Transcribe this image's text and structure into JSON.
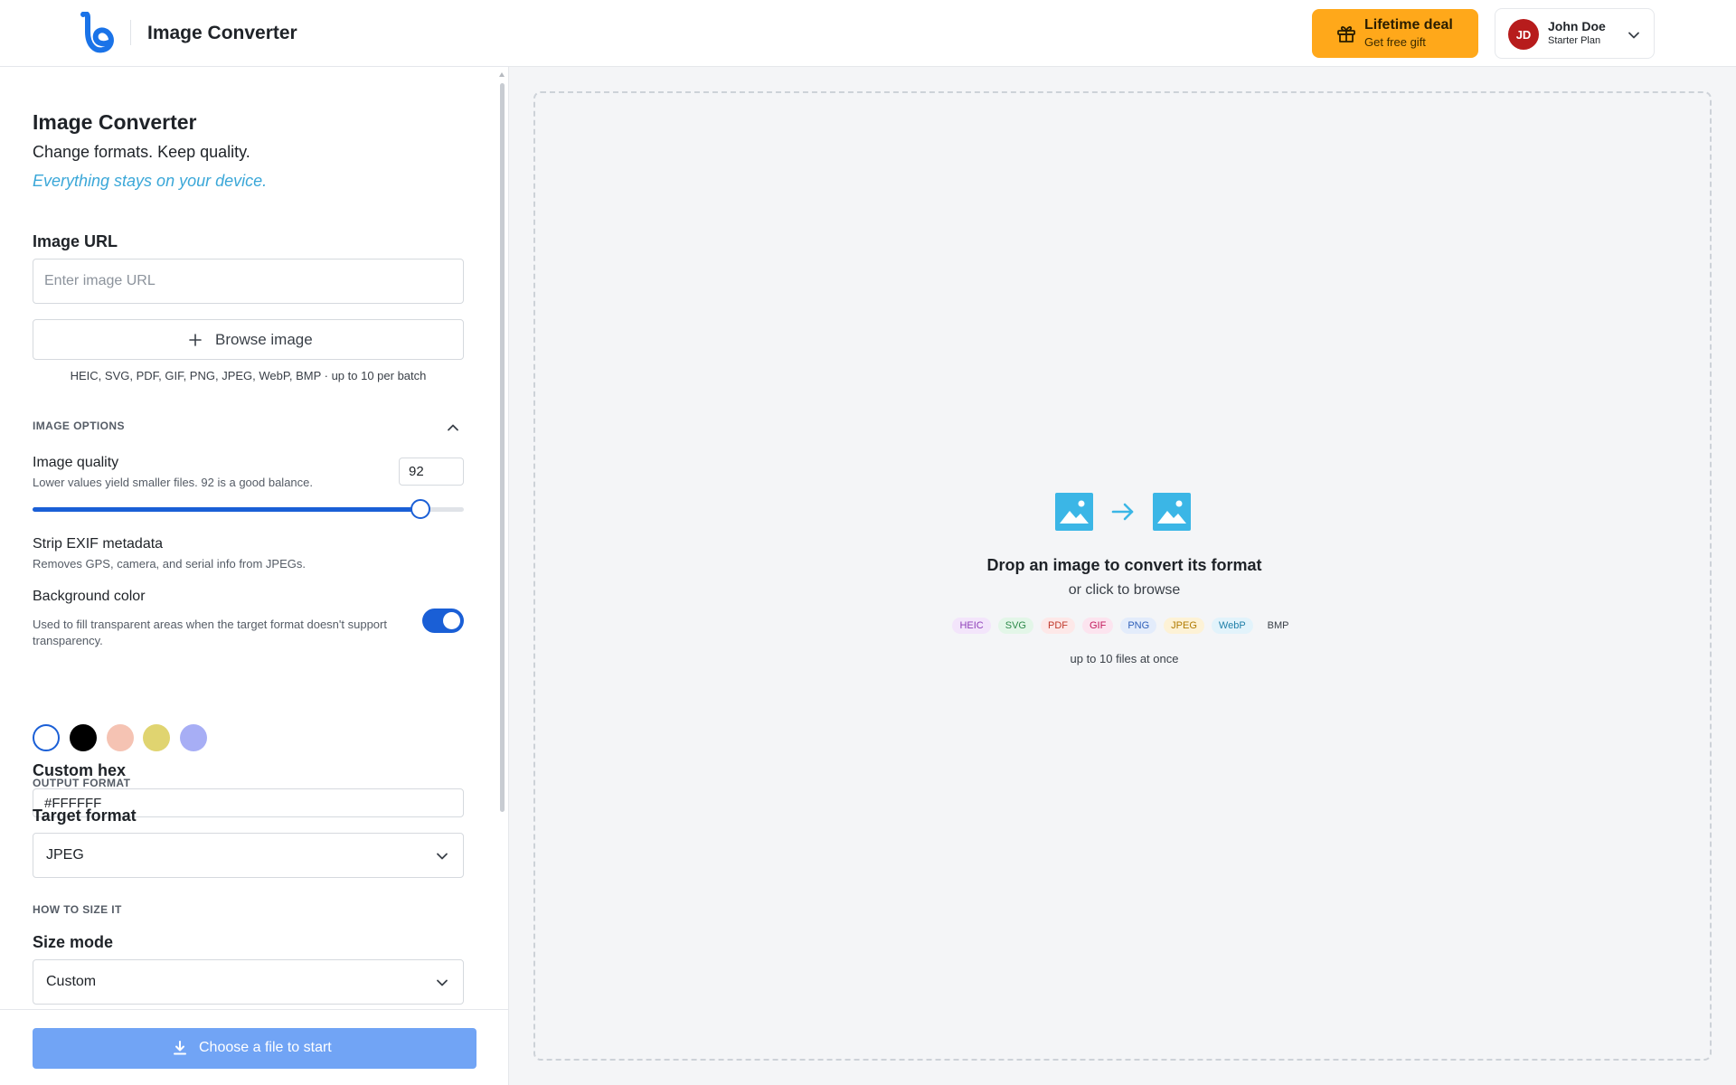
{
  "header": {
    "app_title": "Image Converter",
    "deal": {
      "title": "Lifetime deal",
      "subtitle": "Get free gift"
    },
    "user": {
      "initials": "JD",
      "name": "John Doe",
      "plan": "Starter Plan"
    }
  },
  "sidebar": {
    "title": "Image Converter",
    "subtitle": "Change formats. Keep quality.",
    "tagline": "Everything stays on your device.",
    "image_url": {
      "label": "Image URL",
      "placeholder": "Enter image URL",
      "value": ""
    },
    "browse_label": "Browse image",
    "formats_hint": "HEIC, SVG, PDF, GIF, PNG, JPEG, WebP, BMP · up to 10 per batch",
    "image_options": {
      "heading": "IMAGE OPTIONS",
      "quality": {
        "label": "Image quality",
        "desc": "Lower values yield smaller files. 92 is a good balance.",
        "value": "92",
        "slider_percent": 90
      },
      "strip_exif": {
        "label": "Strip EXIF metadata",
        "desc": "Removes GPS, camera, and serial info from JPEGs.",
        "enabled": true
      },
      "background": {
        "label": "Background color",
        "desc": "Used to fill transparent areas when the target format doesn't support transparency.",
        "swatches": [
          "#FFFFFF",
          "#000000",
          "#F5C3B3",
          "#E0D470",
          "#A7AEF5"
        ],
        "selected": "#FFFFFF"
      },
      "custom_hex": {
        "label": "Custom hex",
        "value": "#FFFFFF"
      }
    },
    "output_format": {
      "heading": "OUTPUT FORMAT",
      "label": "Target format",
      "value": "JPEG"
    },
    "sizing": {
      "heading": "HOW TO SIZE IT",
      "label": "Size mode",
      "value": "Custom"
    },
    "start_label": "Choose a file to start"
  },
  "dropzone": {
    "title": "Drop an image to convert its format",
    "subtitle": "or click to browse",
    "formats": [
      {
        "label": "HEIC",
        "bg": "#f3e5fb",
        "fg": "#8e3fb8"
      },
      {
        "label": "SVG",
        "bg": "#e3f6e8",
        "fg": "#2d8a4a"
      },
      {
        "label": "PDF",
        "bg": "#fde8e8",
        "fg": "#c0392b"
      },
      {
        "label": "GIF",
        "bg": "#fce4ef",
        "fg": "#c2185b"
      },
      {
        "label": "PNG",
        "bg": "#e3ecfb",
        "fg": "#2f5fb8"
      },
      {
        "label": "JPEG",
        "bg": "#fdf2d6",
        "fg": "#b07a00"
      },
      {
        "label": "WebP",
        "bg": "#e2f3fb",
        "fg": "#1f7fa8"
      },
      {
        "label": "BMP",
        "bg": "#f4f5f7",
        "fg": "#3a4048"
      }
    ],
    "limit": "up to 10 files at once"
  },
  "colors": {
    "accent": "#1a5fd6",
    "brand": "#1a73e8",
    "deal": "#ffa81a",
    "icon": "#3bb6e6"
  }
}
